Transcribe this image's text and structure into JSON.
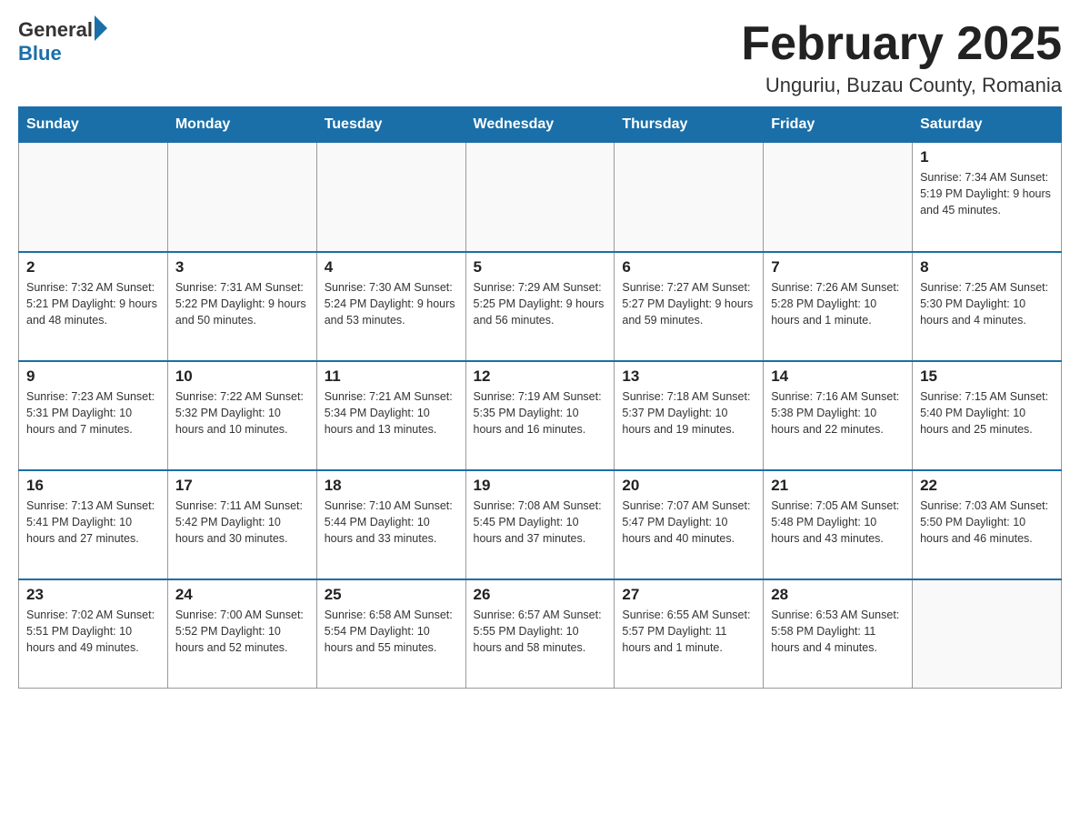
{
  "logo": {
    "general": "General",
    "blue": "Blue"
  },
  "header": {
    "title": "February 2025",
    "location": "Unguriu, Buzau County, Romania"
  },
  "weekdays": [
    "Sunday",
    "Monday",
    "Tuesday",
    "Wednesday",
    "Thursday",
    "Friday",
    "Saturday"
  ],
  "weeks": [
    [
      {
        "day": "",
        "info": ""
      },
      {
        "day": "",
        "info": ""
      },
      {
        "day": "",
        "info": ""
      },
      {
        "day": "",
        "info": ""
      },
      {
        "day": "",
        "info": ""
      },
      {
        "day": "",
        "info": ""
      },
      {
        "day": "1",
        "info": "Sunrise: 7:34 AM\nSunset: 5:19 PM\nDaylight: 9 hours and 45 minutes."
      }
    ],
    [
      {
        "day": "2",
        "info": "Sunrise: 7:32 AM\nSunset: 5:21 PM\nDaylight: 9 hours and 48 minutes."
      },
      {
        "day": "3",
        "info": "Sunrise: 7:31 AM\nSunset: 5:22 PM\nDaylight: 9 hours and 50 minutes."
      },
      {
        "day": "4",
        "info": "Sunrise: 7:30 AM\nSunset: 5:24 PM\nDaylight: 9 hours and 53 minutes."
      },
      {
        "day": "5",
        "info": "Sunrise: 7:29 AM\nSunset: 5:25 PM\nDaylight: 9 hours and 56 minutes."
      },
      {
        "day": "6",
        "info": "Sunrise: 7:27 AM\nSunset: 5:27 PM\nDaylight: 9 hours and 59 minutes."
      },
      {
        "day": "7",
        "info": "Sunrise: 7:26 AM\nSunset: 5:28 PM\nDaylight: 10 hours and 1 minute."
      },
      {
        "day": "8",
        "info": "Sunrise: 7:25 AM\nSunset: 5:30 PM\nDaylight: 10 hours and 4 minutes."
      }
    ],
    [
      {
        "day": "9",
        "info": "Sunrise: 7:23 AM\nSunset: 5:31 PM\nDaylight: 10 hours and 7 minutes."
      },
      {
        "day": "10",
        "info": "Sunrise: 7:22 AM\nSunset: 5:32 PM\nDaylight: 10 hours and 10 minutes."
      },
      {
        "day": "11",
        "info": "Sunrise: 7:21 AM\nSunset: 5:34 PM\nDaylight: 10 hours and 13 minutes."
      },
      {
        "day": "12",
        "info": "Sunrise: 7:19 AM\nSunset: 5:35 PM\nDaylight: 10 hours and 16 minutes."
      },
      {
        "day": "13",
        "info": "Sunrise: 7:18 AM\nSunset: 5:37 PM\nDaylight: 10 hours and 19 minutes."
      },
      {
        "day": "14",
        "info": "Sunrise: 7:16 AM\nSunset: 5:38 PM\nDaylight: 10 hours and 22 minutes."
      },
      {
        "day": "15",
        "info": "Sunrise: 7:15 AM\nSunset: 5:40 PM\nDaylight: 10 hours and 25 minutes."
      }
    ],
    [
      {
        "day": "16",
        "info": "Sunrise: 7:13 AM\nSunset: 5:41 PM\nDaylight: 10 hours and 27 minutes."
      },
      {
        "day": "17",
        "info": "Sunrise: 7:11 AM\nSunset: 5:42 PM\nDaylight: 10 hours and 30 minutes."
      },
      {
        "day": "18",
        "info": "Sunrise: 7:10 AM\nSunset: 5:44 PM\nDaylight: 10 hours and 33 minutes."
      },
      {
        "day": "19",
        "info": "Sunrise: 7:08 AM\nSunset: 5:45 PM\nDaylight: 10 hours and 37 minutes."
      },
      {
        "day": "20",
        "info": "Sunrise: 7:07 AM\nSunset: 5:47 PM\nDaylight: 10 hours and 40 minutes."
      },
      {
        "day": "21",
        "info": "Sunrise: 7:05 AM\nSunset: 5:48 PM\nDaylight: 10 hours and 43 minutes."
      },
      {
        "day": "22",
        "info": "Sunrise: 7:03 AM\nSunset: 5:50 PM\nDaylight: 10 hours and 46 minutes."
      }
    ],
    [
      {
        "day": "23",
        "info": "Sunrise: 7:02 AM\nSunset: 5:51 PM\nDaylight: 10 hours and 49 minutes."
      },
      {
        "day": "24",
        "info": "Sunrise: 7:00 AM\nSunset: 5:52 PM\nDaylight: 10 hours and 52 minutes."
      },
      {
        "day": "25",
        "info": "Sunrise: 6:58 AM\nSunset: 5:54 PM\nDaylight: 10 hours and 55 minutes."
      },
      {
        "day": "26",
        "info": "Sunrise: 6:57 AM\nSunset: 5:55 PM\nDaylight: 10 hours and 58 minutes."
      },
      {
        "day": "27",
        "info": "Sunrise: 6:55 AM\nSunset: 5:57 PM\nDaylight: 11 hours and 1 minute."
      },
      {
        "day": "28",
        "info": "Sunrise: 6:53 AM\nSunset: 5:58 PM\nDaylight: 11 hours and 4 minutes."
      },
      {
        "day": "",
        "info": ""
      }
    ]
  ]
}
